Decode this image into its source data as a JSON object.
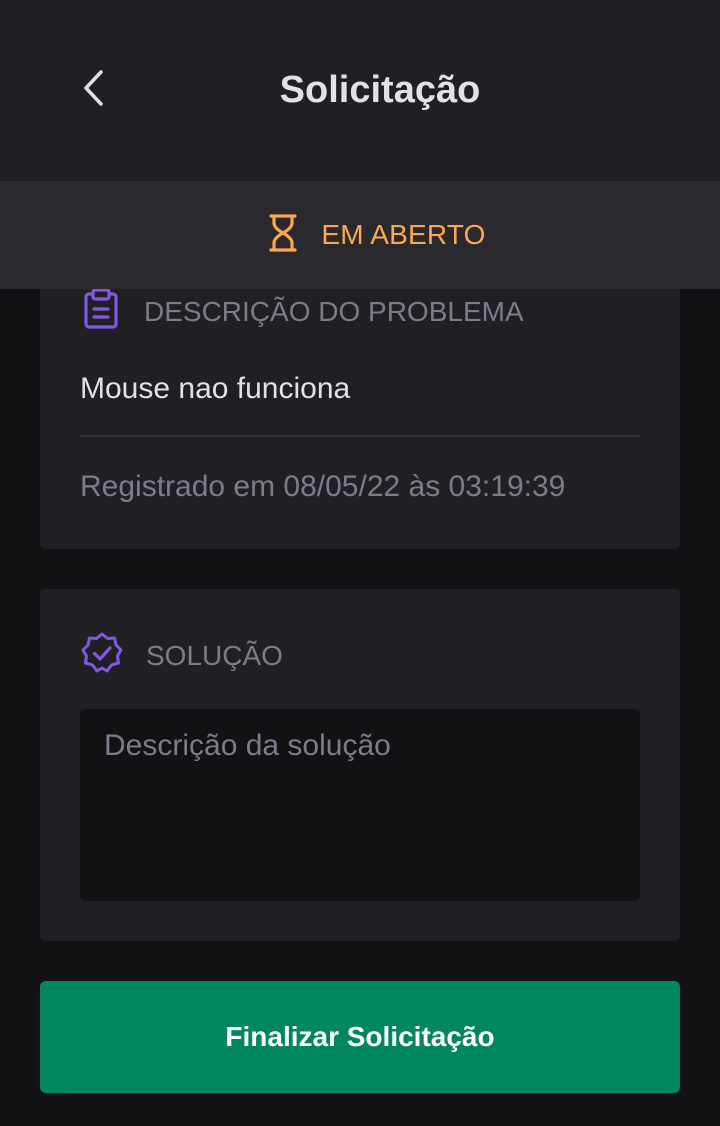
{
  "header": {
    "title": "Solicitação",
    "back_icon": "chevron-left-icon"
  },
  "status": {
    "label": "EM ABERTO",
    "icon": "hourglass-icon",
    "color": "#fba94c"
  },
  "problem": {
    "label": "DESCRIÇÃO DO PROBLEMA",
    "icon": "clipboard-icon",
    "description": "Mouse nao funciona",
    "registered": "Registrado em 08/05/22 às 03:19:39"
  },
  "solution": {
    "label": "SOLUÇÃO",
    "icon": "verified-badge-icon",
    "placeholder": "Descrição da solução",
    "value": ""
  },
  "actions": {
    "finish_label": "Finalizar Solicitação",
    "finish_color": "#00875f"
  },
  "colors": {
    "accent": "#8257e5",
    "background": "#121214",
    "surface": "#202024"
  }
}
